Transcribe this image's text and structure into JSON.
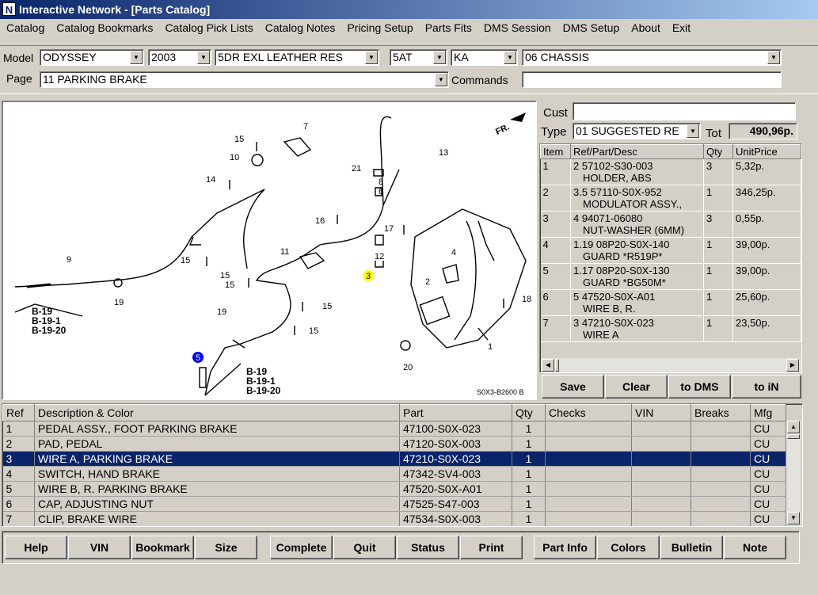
{
  "window": {
    "title": "Interactive Network - [Parts Catalog]",
    "icon_letter": "N"
  },
  "menu": [
    "Catalog",
    "Catalog Bookmarks",
    "Catalog Pick Lists",
    "Catalog Notes",
    "Pricing Setup",
    "Parts Fits",
    "DMS Session",
    "DMS Setup",
    "About",
    "Exit"
  ],
  "selectors": {
    "model_label": "Model",
    "model": "ODYSSEY",
    "year": "2003",
    "trim": "5DR EXL LEATHER RES",
    "transmission": "5AT",
    "region": "KA",
    "section": "06  CHASSIS",
    "page_label": "Page",
    "page": "11  PARKING BRAKE",
    "commands_label": "Commands",
    "commands": ""
  },
  "diagram": {
    "code": "S0X3-B2600 B",
    "direction": "FR.",
    "callouts": [
      "1",
      "2",
      "3",
      "4",
      "5",
      "6",
      "7",
      "8",
      "9",
      "10",
      "11",
      "12",
      "13",
      "14",
      "15",
      "16",
      "17",
      "18",
      "19",
      "20",
      "21"
    ],
    "ref_labels": [
      "B-19",
      "B-19-1",
      "B-19-20"
    ]
  },
  "quote": {
    "cust_label": "Cust",
    "cust_value": "",
    "type_label": "Type",
    "type_value": "01  SUGGESTED RE",
    "tot_label": "Tot",
    "total": "490,96р.",
    "columns": [
      "Item",
      "Ref/Part/Desc",
      "Qty",
      "UnitPrice"
    ],
    "rows": [
      {
        "item": "1",
        "ref": "2  57102-S30-003",
        "desc": "HOLDER, ABS",
        "qty": "3",
        "price": "5,32р."
      },
      {
        "item": "2",
        "ref": "3.5  57110-S0X-952",
        "desc": "MODULATOR ASSY.,",
        "qty": "1",
        "price": "346,25р."
      },
      {
        "item": "3",
        "ref": "4  94071-06080",
        "desc": "NUT-WASHER (6MM)",
        "qty": "3",
        "price": "0,55р."
      },
      {
        "item": "4",
        "ref": "1.19  08P20-S0X-140",
        "desc": "GUARD *R519P*",
        "qty": "1",
        "price": "39,00р."
      },
      {
        "item": "5",
        "ref": "1.17  08P20-S0X-130",
        "desc": "GUARD *BG50M*",
        "qty": "1",
        "price": "39,00р."
      },
      {
        "item": "6",
        "ref": "5  47520-S0X-A01",
        "desc": "WIRE B, R.",
        "qty": "1",
        "price": "25,60р."
      },
      {
        "item": "7",
        "ref": "3  47210-S0X-023",
        "desc": "WIRE A",
        "qty": "1",
        "price": "23,50р."
      }
    ],
    "buttons": [
      "Save",
      "Clear",
      "to DMS",
      "to iN"
    ]
  },
  "parts": {
    "columns": [
      "Ref",
      "Description & Color",
      "Part",
      "Qty",
      "Checks",
      "VIN",
      "Breaks",
      "Mfg"
    ],
    "selected_index": 2,
    "rows": [
      {
        "ref": "1",
        "desc": "PEDAL ASSY., FOOT PARKING BRAKE",
        "part": "47100-S0X-023",
        "qty": "1",
        "mfg": "CU"
      },
      {
        "ref": "2",
        "desc": "PAD, PEDAL",
        "part": "47120-S0X-003",
        "qty": "1",
        "mfg": "CU"
      },
      {
        "ref": "3",
        "desc": "WIRE A, PARKING BRAKE",
        "part": "47210-S0X-023",
        "qty": "1",
        "mfg": "CU"
      },
      {
        "ref": "4",
        "desc": "SWITCH, HAND BRAKE",
        "part": "47342-SV4-003",
        "qty": "1",
        "mfg": "CU"
      },
      {
        "ref": "5",
        "desc": "WIRE B, R. PARKING BRAKE",
        "part": "47520-S0X-A01",
        "qty": "1",
        "mfg": "CU"
      },
      {
        "ref": "6",
        "desc": "CAP, ADJUSTING NUT",
        "part": "47525-S47-003",
        "qty": "1",
        "mfg": "CU"
      },
      {
        "ref": "7",
        "desc": "CLIP, BRAKE WIRE",
        "part": "47534-S0X-003",
        "qty": "1",
        "mfg": "CU"
      }
    ]
  },
  "toolbar": [
    "Help",
    "VIN",
    "Bookmark",
    "Size",
    "Complete",
    "Quit",
    "Status",
    "Print",
    "Part Info",
    "Colors",
    "Bulletin",
    "Note"
  ],
  "colors": {
    "selection": "#0a246a",
    "highlight_yellow": "#ffff00",
    "highlight_blue": "#0000ff"
  }
}
